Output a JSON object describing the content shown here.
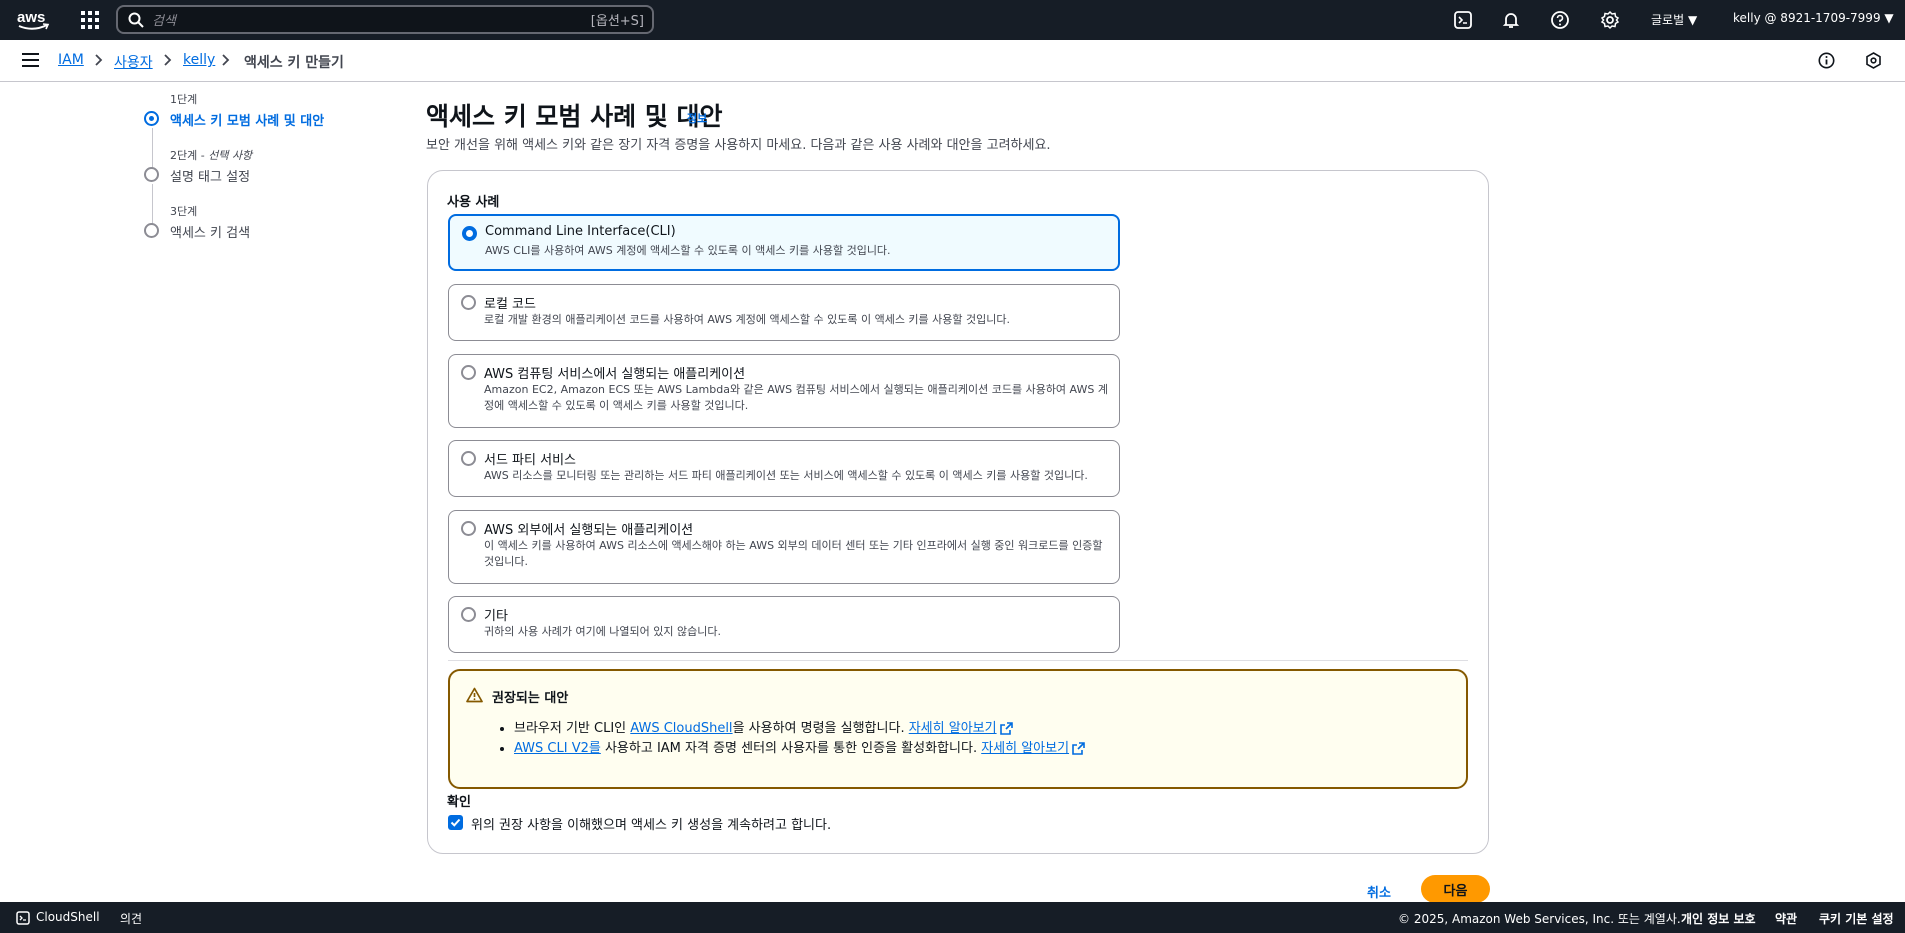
{
  "topbar": {
    "logo": "aws",
    "search_placeholder": "검색",
    "search_shortcut": "[옵션+S]",
    "region": "글로벌",
    "account": "kelly @ 8921-1709-7999"
  },
  "breadcrumb": [
    "IAM",
    "사용자",
    "kelly",
    "액세스 키 만들기"
  ],
  "steps": [
    {
      "label": "1단계",
      "title": "액세스 키 모범 사례 및 대안"
    },
    {
      "label": "2단계 - ",
      "label_italic": "선택 사항",
      "title": "설명 태그 설정"
    },
    {
      "label": "3단계",
      "title": "액세스 키 검색"
    }
  ],
  "page": {
    "title": "액세스 키 모범 사례 및 대안",
    "info": "정보",
    "description": "보안 개선을 위해 액세스 키와 같은 장기 자격 증명을 사용하지 마세요. 다음과 같은 사용 사례와 대안을 고려하세요."
  },
  "use_case_label": "사용 사례",
  "use_cases": [
    {
      "title": "Command Line Interface(CLI)",
      "desc": "AWS CLI를 사용하여 AWS 계정에 액세스할 수 있도록 이 액세스 키를 사용할 것입니다."
    },
    {
      "title": "로컬 코드",
      "desc": "로컬 개발 환경의 애플리케이션 코드를 사용하여 AWS 계정에 액세스할 수 있도록 이 액세스 키를 사용할 것입니다."
    },
    {
      "title": "AWS 컴퓨팅 서비스에서 실행되는 애플리케이션",
      "desc": "Amazon EC2, Amazon ECS 또는 AWS Lambda와 같은 AWS 컴퓨팅 서비스에서 실행되는 애플리케이션 코드를 사용하여 AWS 계정에 액세스할 수 있도록 이 액세스 키를 사용할 것입니다."
    },
    {
      "title": "서드 파티 서비스",
      "desc": "AWS 리소스를 모니터링 또는 관리하는 서드 파티 애플리케이션 또는 서비스에 액세스할 수 있도록 이 액세스 키를 사용할 것입니다."
    },
    {
      "title": "AWS 외부에서 실행되는 애플리케이션",
      "desc": "이 액세스 키를 사용하여 AWS 리소스에 액세스해야 하는 AWS 외부의 데이터 센터 또는 기타 인프라에서 실행 중인 워크로드를 인증할 것입니다."
    },
    {
      "title": "기타",
      "desc": "귀하의 사용 사례가 여기에 나열되어 있지 않습니다."
    }
  ],
  "alert": {
    "title": "권장되는 대안",
    "item1_pre": "브라우저 기반 CLI인 ",
    "item1_link": "AWS CloudShell",
    "item1_post": "을 사용하여 명령을 실행합니다. ",
    "item1_more": "자세히 알아보기",
    "item2_link": "AWS CLI V2를",
    "item2_post": " 사용하고 IAM 자격 증명 센터의 사용자를 통한 인증을 활성화합니다. ",
    "item2_more": "자세히 알아보기"
  },
  "confirm": {
    "label": "확인",
    "checkbox_text": "위의 권장 사항을 이해했으며 액세스 키 생성을 계속하려고 합니다."
  },
  "actions": {
    "cancel": "취소",
    "next": "다음"
  },
  "footer": {
    "cloudshell": "CloudShell",
    "feedback": "의견",
    "copyright": "© 2025, Amazon Web Services, Inc. 또는 계열사.",
    "privacy": "개인 정보 보호",
    "terms": "약관",
    "cookies": "쿠키 기본 설정"
  },
  "colors": {
    "accent": "#006ce0",
    "nav": "#161d26",
    "primary_button": "#ff9900",
    "warning": "#855900"
  }
}
